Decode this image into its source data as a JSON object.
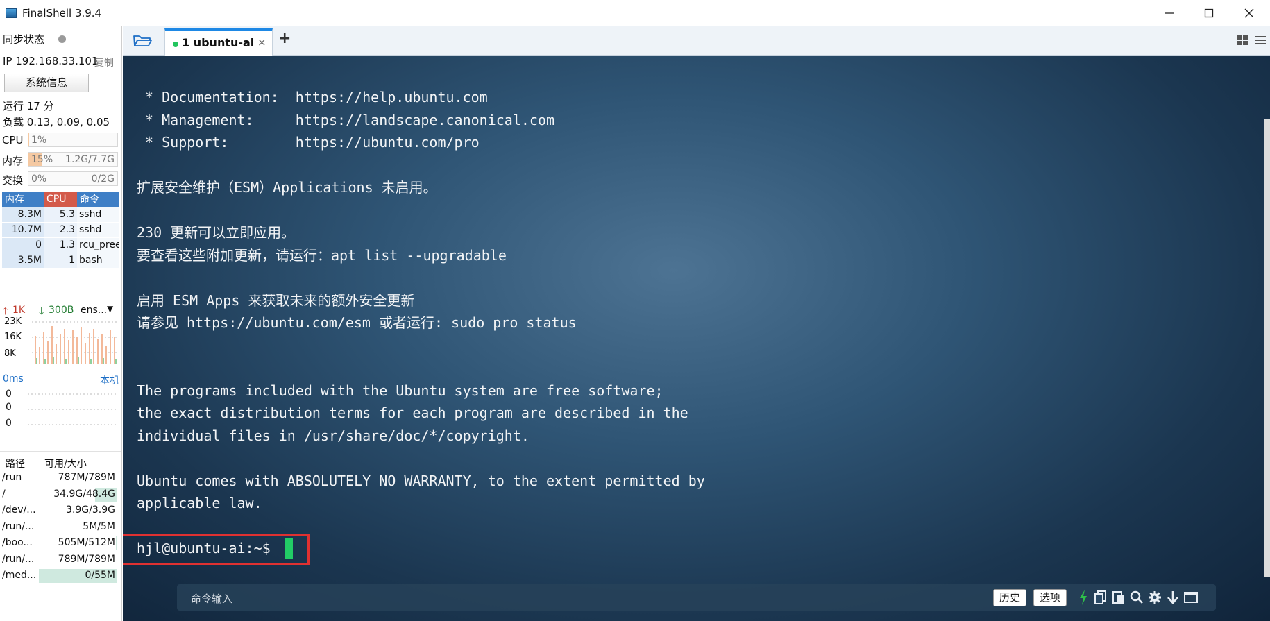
{
  "window": {
    "title": "FinalShell 3.9.4"
  },
  "sidebar": {
    "sync_label": "同步状态",
    "ip": "IP 192.168.33.101",
    "copy_label": "复制",
    "sysinfo_button": "系统信息",
    "uptime": "运行 17 分",
    "load": "负载 0.13, 0.09, 0.05",
    "cpu": {
      "label": "CPU",
      "percent_text": "1%",
      "fraction": 0.01
    },
    "memory": {
      "label": "内存",
      "percent_text": "15%",
      "size_text": "1.2G/7.7G",
      "fraction": 0.15
    },
    "swap": {
      "label": "交换",
      "percent_text": "0%",
      "size_text": "0/2G",
      "fraction": 0.0
    },
    "process_table": {
      "headers": [
        "内存",
        "CPU",
        "命令"
      ],
      "rows": [
        {
          "mem": "8.3M",
          "cpu": "5.3",
          "cmd": "sshd"
        },
        {
          "mem": "10.7M",
          "cpu": "2.3",
          "cmd": "sshd"
        },
        {
          "mem": "0",
          "cpu": "1.3",
          "cmd": "rcu_pree"
        },
        {
          "mem": "3.5M",
          "cpu": "1",
          "cmd": "bash"
        }
      ]
    },
    "network": {
      "upload": "1K",
      "download": "300B",
      "interface": "ens...",
      "y_ticks": [
        "23K",
        "16K",
        "8K"
      ]
    },
    "latency": {
      "value": "0ms",
      "target": "本机",
      "y_ticks": [
        "0",
        "0",
        "0"
      ]
    },
    "disk": {
      "headers": [
        "路径",
        "可用/大小"
      ],
      "rows": [
        {
          "path": "/run",
          "usage": "787M/789M",
          "used_fraction": 0.0
        },
        {
          "path": "/",
          "usage": "34.9G/48.4G",
          "used_fraction": 0.28
        },
        {
          "path": "/dev/...",
          "usage": "3.9G/3.9G",
          "used_fraction": 0.0
        },
        {
          "path": "/run/...",
          "usage": "5M/5M",
          "used_fraction": 0.0
        },
        {
          "path": "/boo...",
          "usage": "505M/512M",
          "used_fraction": 0.01
        },
        {
          "path": "/run/...",
          "usage": "789M/789M",
          "used_fraction": 0.0
        },
        {
          "path": "/med...",
          "usage": "0/55M",
          "used_fraction": 1.0
        }
      ]
    }
  },
  "tabs": {
    "active_label": "1 ubuntu-ai",
    "close_glyph": "×",
    "add_glyph": "+"
  },
  "terminal": {
    "lines": [
      " * Documentation:  https://help.ubuntu.com",
      " * Management:     https://landscape.canonical.com",
      " * Support:        https://ubuntu.com/pro",
      "",
      "扩展安全维护（ESM）Applications 未启用。",
      "",
      "230 更新可以立即应用。",
      "要查看这些附加更新，请运行：apt list --upgradable",
      "",
      "启用 ESM Apps 来获取未来的额外安全更新",
      "请参见 https://ubuntu.com/esm 或者运行: sudo pro status",
      "",
      "",
      "The programs included with the Ubuntu system are free software;",
      "the exact distribution terms for each program are described in the",
      "individual files in /usr/share/doc/*/copyright.",
      "",
      "Ubuntu comes with ABSOLUTELY NO WARRANTY, to the extent permitted by",
      "applicable law.",
      ""
    ],
    "prompt": "hjl@ubuntu-ai:~$"
  },
  "command_bar": {
    "placeholder": "命令输入",
    "history_button": "历史",
    "options_button": "选项"
  },
  "colors": {
    "accent_blue": "#1e88e5",
    "cursor_green": "#22cc66",
    "highlight_red": "#e03131",
    "tab_status_green": "#22c55e"
  }
}
